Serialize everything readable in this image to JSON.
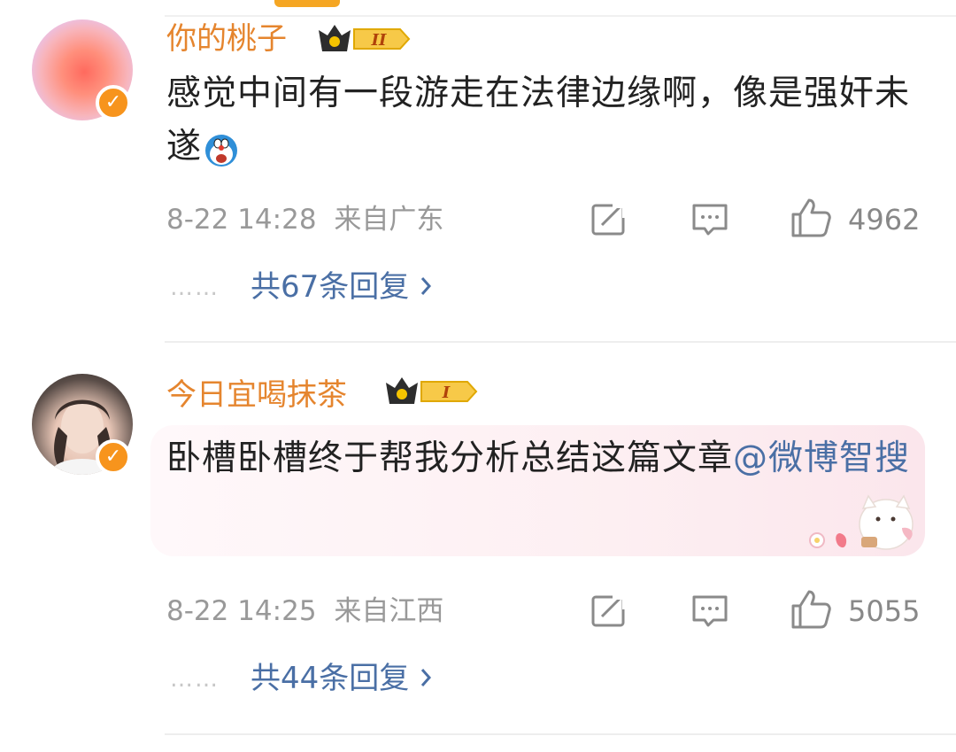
{
  "comments": [
    {
      "username": "你的桃子",
      "level_badge": "II",
      "text": "感觉中间有一段游走在法律边缘啊，像是强奸未遂",
      "emoji": "doraemon-emoji",
      "time": "8-22 14:28",
      "location": "来自广东",
      "likes": "4962",
      "replies_label": "共67条回复",
      "dots": "……"
    },
    {
      "username": "今日宜喝抹茶",
      "level_badge": "I",
      "text_plain": "卧槽卧槽终于帮我分析总结这篇文章",
      "mention": "@微博智搜",
      "time": "8-22 14:25",
      "location": "来自江西",
      "likes": "5055",
      "replies_label": "共44条回复",
      "dots": "……"
    }
  ],
  "colors": {
    "username": "#e5852e",
    "link": "#4a6fa5",
    "verified": "#f7941d"
  }
}
